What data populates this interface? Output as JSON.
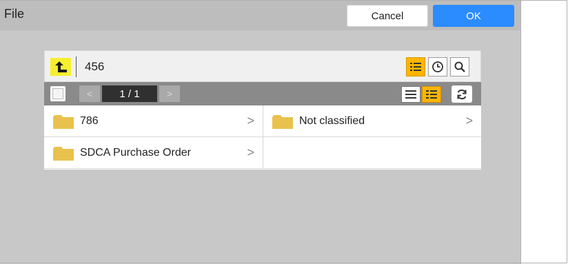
{
  "window": {
    "title": "File"
  },
  "actions": {
    "cancel_label": "Cancel",
    "ok_label": "OK"
  },
  "path": {
    "current": "456"
  },
  "pager": {
    "prev": "<",
    "next": ">",
    "indicator": "1 / 1"
  },
  "folders": [
    {
      "name": "786"
    },
    {
      "name": "Not classified"
    },
    {
      "name": "SDCA Purchase Order"
    }
  ],
  "chevron": ">",
  "colors": {
    "accent": "#ffb500",
    "ok": "#2b8cff",
    "folder": "#e9c14d",
    "highlight": "#f6ef2d"
  },
  "icons": [
    "up-arrow-icon",
    "list-view-icon",
    "clock-icon",
    "search-icon",
    "checkbox-icon",
    "detail-view-icon",
    "thumbnail-view-icon",
    "refresh-icon",
    "folder-icon",
    "chevron-right-icon"
  ]
}
